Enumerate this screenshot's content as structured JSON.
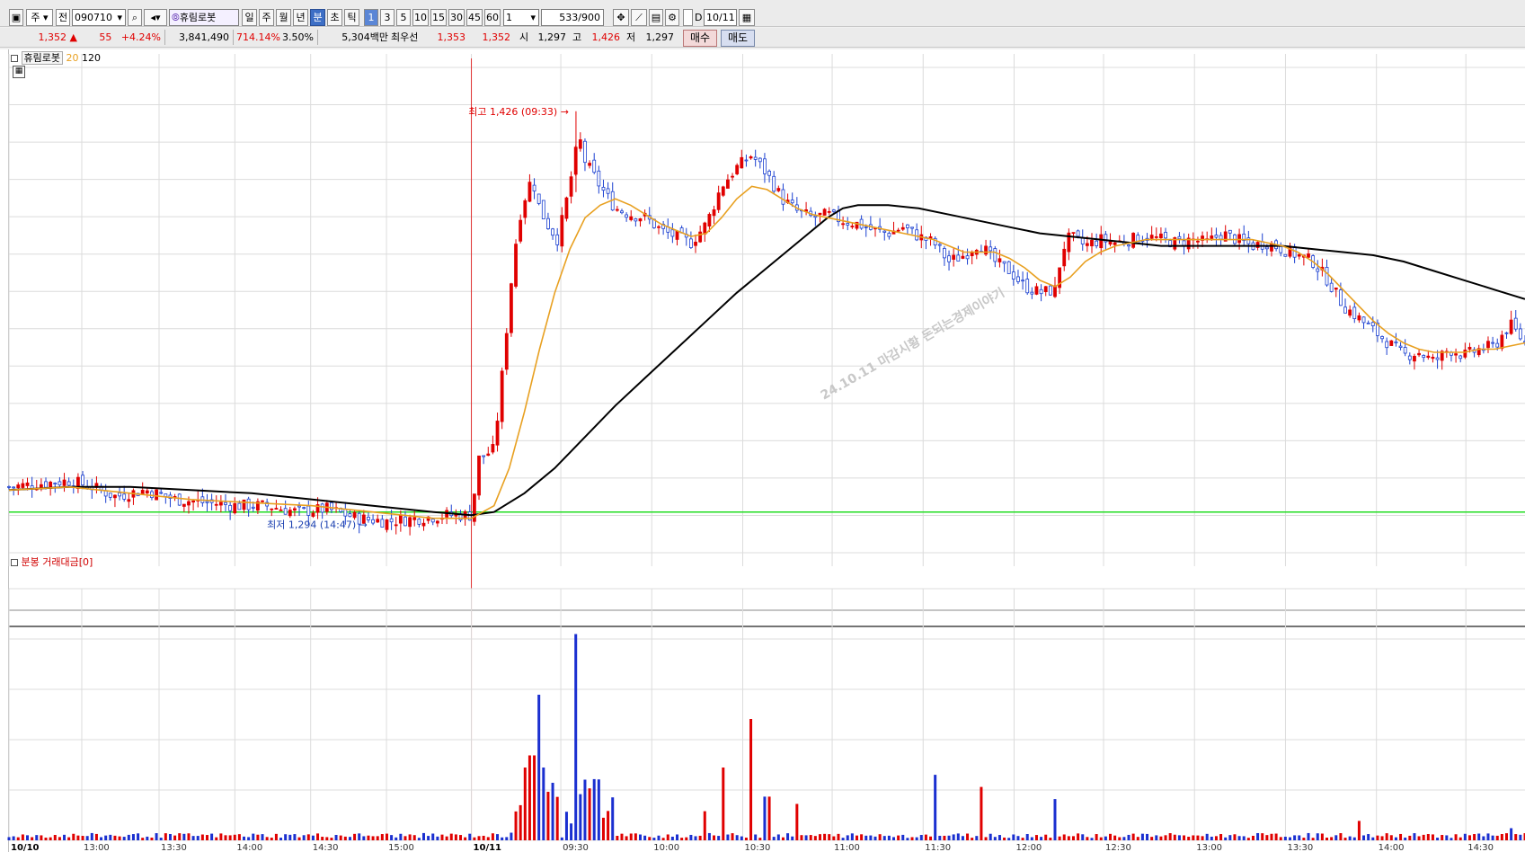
{
  "toolbar": {
    "market_select": "주",
    "type_select": "전",
    "stock_code": "090710",
    "stock_name": "휴림로봇",
    "period_buttons": [
      "일",
      "주",
      "월",
      "년",
      "분",
      "초",
      "틱"
    ],
    "active_period": "분",
    "interval_buttons": [
      "1",
      "3",
      "5",
      "10",
      "15",
      "30",
      "45",
      "60"
    ],
    "active_interval": "1",
    "interval_input": "1",
    "count_value": "533",
    "count_max": "/900",
    "checkbox_label": "D",
    "date_value": "10/11"
  },
  "quote": {
    "price": "1,352",
    "arrow": "▲",
    "change": "55",
    "change_pct": "+4.24%",
    "volume": "3,841,490",
    "volume_ratio": "714.14%",
    "turnover": "3.50%",
    "amount": "5,304백만",
    "best_label": "최우선",
    "best_ask": "1,353",
    "best_bid": "1,352",
    "open_label": "시",
    "open": "1,297",
    "high_label": "고",
    "high": "1,426",
    "low_label": "저",
    "low": "1,297",
    "buy_button": "매수",
    "sell_button": "매도"
  },
  "price_panel": {
    "legend_name": "휴림로봇",
    "ma_short": "20",
    "ma_long": "120",
    "ma_short_color": "#e8a020",
    "ma_long_color": "#000000",
    "high_marker": "최고 1,426 (09:33)",
    "low_marker": "최저 1,294 (14:47)",
    "watermark": "24.10.11 마감시황 돈되는경제이야기"
  },
  "volume_panel": {
    "title": "분봉 거래대금[0]"
  },
  "chart_data": {
    "type": "candlestick",
    "ylim": [
      1285,
      1440
    ],
    "day_separator": "10/11",
    "x_labels": [
      "10/10",
      "13:00",
      "13:30",
      "14:00",
      "14:30",
      "15:00",
      "10/11",
      "09:30",
      "10:00",
      "10:30",
      "11:00",
      "11:30",
      "12:00",
      "12:30",
      "13:00",
      "13:30",
      "14:00",
      "14:30"
    ],
    "x_fracs": [
      0.0,
      0.048,
      0.099,
      0.149,
      0.199,
      0.249,
      0.305,
      0.364,
      0.424,
      0.484,
      0.543,
      0.603,
      0.663,
      0.722,
      0.782,
      0.842,
      0.902,
      0.961
    ],
    "close_path": [
      [
        0.0,
        1306
      ],
      [
        0.02,
        1307
      ],
      [
        0.04,
        1308
      ],
      [
        0.055,
        1306
      ],
      [
        0.07,
        1303
      ],
      [
        0.09,
        1305
      ],
      [
        0.11,
        1302
      ],
      [
        0.13,
        1301
      ],
      [
        0.15,
        1300
      ],
      [
        0.17,
        1300
      ],
      [
        0.19,
        1298
      ],
      [
        0.21,
        1299
      ],
      [
        0.23,
        1296
      ],
      [
        0.25,
        1295
      ],
      [
        0.27,
        1296
      ],
      [
        0.29,
        1297
      ],
      [
        0.305,
        1297
      ],
      [
        0.31,
        1315
      ],
      [
        0.32,
        1318
      ],
      [
        0.326,
        1345
      ],
      [
        0.333,
        1380
      ],
      [
        0.338,
        1395
      ],
      [
        0.345,
        1405
      ],
      [
        0.35,
        1395
      ],
      [
        0.355,
        1390
      ],
      [
        0.362,
        1385
      ],
      [
        0.368,
        1398
      ],
      [
        0.376,
        1418
      ],
      [
        0.38,
        1410
      ],
      [
        0.39,
        1402
      ],
      [
        0.4,
        1395
      ],
      [
        0.41,
        1393
      ],
      [
        0.42,
        1392
      ],
      [
        0.43,
        1388
      ],
      [
        0.44,
        1386
      ],
      [
        0.45,
        1384
      ],
      [
        0.46,
        1390
      ],
      [
        0.47,
        1402
      ],
      [
        0.48,
        1408
      ],
      [
        0.49,
        1412
      ],
      [
        0.5,
        1406
      ],
      [
        0.51,
        1398
      ],
      [
        0.52,
        1394
      ],
      [
        0.53,
        1392
      ],
      [
        0.54,
        1393
      ],
      [
        0.55,
        1391
      ],
      [
        0.56,
        1390
      ],
      [
        0.57,
        1388
      ],
      [
        0.58,
        1387
      ],
      [
        0.59,
        1389
      ],
      [
        0.6,
        1386
      ],
      [
        0.61,
        1384
      ],
      [
        0.62,
        1378
      ],
      [
        0.63,
        1380
      ],
      [
        0.64,
        1384
      ],
      [
        0.65,
        1378
      ],
      [
        0.66,
        1375
      ],
      [
        0.67,
        1370
      ],
      [
        0.68,
        1368
      ],
      [
        0.69,
        1369
      ],
      [
        0.695,
        1382
      ],
      [
        0.7,
        1386
      ],
      [
        0.71,
        1383
      ],
      [
        0.72,
        1385
      ],
      [
        0.73,
        1384
      ],
      [
        0.74,
        1385
      ],
      [
        0.75,
        1386
      ],
      [
        0.76,
        1385
      ],
      [
        0.77,
        1384
      ],
      [
        0.78,
        1385
      ],
      [
        0.79,
        1384
      ],
      [
        0.8,
        1387
      ],
      [
        0.81,
        1385
      ],
      [
        0.82,
        1383
      ],
      [
        0.83,
        1384
      ],
      [
        0.84,
        1382
      ],
      [
        0.85,
        1380
      ],
      [
        0.86,
        1378
      ],
      [
        0.87,
        1372
      ],
      [
        0.88,
        1364
      ],
      [
        0.89,
        1360
      ],
      [
        0.9,
        1356
      ],
      [
        0.91,
        1352
      ],
      [
        0.92,
        1348
      ],
      [
        0.93,
        1349
      ],
      [
        0.94,
        1346
      ],
      [
        0.95,
        1350
      ],
      [
        0.96,
        1348
      ],
      [
        0.97,
        1350
      ],
      [
        0.98,
        1351
      ],
      [
        0.99,
        1358
      ],
      [
        1.0,
        1352
      ]
    ],
    "ma20": [
      [
        0.0,
        1305
      ],
      [
        0.04,
        1306
      ],
      [
        0.08,
        1304
      ],
      [
        0.12,
        1302
      ],
      [
        0.16,
        1301
      ],
      [
        0.2,
        1300
      ],
      [
        0.24,
        1298
      ],
      [
        0.28,
        1296
      ],
      [
        0.305,
        1296
      ],
      [
        0.32,
        1300
      ],
      [
        0.33,
        1312
      ],
      [
        0.34,
        1330
      ],
      [
        0.35,
        1350
      ],
      [
        0.36,
        1368
      ],
      [
        0.37,
        1382
      ],
      [
        0.38,
        1392
      ],
      [
        0.39,
        1396
      ],
      [
        0.4,
        1398
      ],
      [
        0.41,
        1396
      ],
      [
        0.42,
        1393
      ],
      [
        0.43,
        1390
      ],
      [
        0.44,
        1388
      ],
      [
        0.45,
        1386
      ],
      [
        0.46,
        1387
      ],
      [
        0.47,
        1392
      ],
      [
        0.48,
        1398
      ],
      [
        0.49,
        1402
      ],
      [
        0.5,
        1401
      ],
      [
        0.51,
        1398
      ],
      [
        0.52,
        1395
      ],
      [
        0.53,
        1393
      ],
      [
        0.54,
        1392
      ],
      [
        0.55,
        1391
      ],
      [
        0.56,
        1390
      ],
      [
        0.57,
        1389
      ],
      [
        0.58,
        1388
      ],
      [
        0.59,
        1387
      ],
      [
        0.6,
        1386
      ],
      [
        0.61,
        1385
      ],
      [
        0.62,
        1383
      ],
      [
        0.63,
        1381
      ],
      [
        0.64,
        1381
      ],
      [
        0.65,
        1381
      ],
      [
        0.66,
        1379
      ],
      [
        0.67,
        1376
      ],
      [
        0.68,
        1372
      ],
      [
        0.69,
        1370
      ],
      [
        0.7,
        1373
      ],
      [
        0.71,
        1378
      ],
      [
        0.72,
        1381
      ],
      [
        0.73,
        1383
      ],
      [
        0.74,
        1384
      ],
      [
        0.75,
        1385
      ],
      [
        0.76,
        1385
      ],
      [
        0.77,
        1385
      ],
      [
        0.78,
        1385
      ],
      [
        0.79,
        1385
      ],
      [
        0.8,
        1385
      ],
      [
        0.81,
        1385
      ],
      [
        0.82,
        1385
      ],
      [
        0.83,
        1384
      ],
      [
        0.84,
        1383
      ],
      [
        0.85,
        1381
      ],
      [
        0.86,
        1378
      ],
      [
        0.87,
        1374
      ],
      [
        0.88,
        1369
      ],
      [
        0.89,
        1364
      ],
      [
        0.9,
        1359
      ],
      [
        0.91,
        1355
      ],
      [
        0.92,
        1352
      ],
      [
        0.93,
        1350
      ],
      [
        0.94,
        1349
      ],
      [
        0.95,
        1349
      ],
      [
        0.96,
        1349
      ],
      [
        0.97,
        1350
      ],
      [
        0.98,
        1350
      ],
      [
        1.0,
        1352
      ]
    ],
    "ma120": [
      [
        0.0,
        1305
      ],
      [
        0.04,
        1306
      ],
      [
        0.08,
        1306
      ],
      [
        0.12,
        1305
      ],
      [
        0.16,
        1304
      ],
      [
        0.2,
        1302
      ],
      [
        0.24,
        1300
      ],
      [
        0.28,
        1298
      ],
      [
        0.305,
        1297
      ],
      [
        0.32,
        1298
      ],
      [
        0.34,
        1304
      ],
      [
        0.36,
        1312
      ],
      [
        0.38,
        1322
      ],
      [
        0.4,
        1332
      ],
      [
        0.42,
        1341
      ],
      [
        0.44,
        1350
      ],
      [
        0.46,
        1359
      ],
      [
        0.48,
        1368
      ],
      [
        0.5,
        1376
      ],
      [
        0.52,
        1384
      ],
      [
        0.54,
        1392
      ],
      [
        0.55,
        1395
      ],
      [
        0.56,
        1396
      ],
      [
        0.58,
        1396
      ],
      [
        0.6,
        1395
      ],
      [
        0.62,
        1393
      ],
      [
        0.64,
        1391
      ],
      [
        0.66,
        1389
      ],
      [
        0.68,
        1387
      ],
      [
        0.7,
        1386
      ],
      [
        0.72,
        1385
      ],
      [
        0.74,
        1384
      ],
      [
        0.76,
        1383
      ],
      [
        0.78,
        1383
      ],
      [
        0.8,
        1383
      ],
      [
        0.82,
        1383
      ],
      [
        0.84,
        1383
      ],
      [
        0.86,
        1382
      ],
      [
        0.88,
        1381
      ],
      [
        0.9,
        1380
      ],
      [
        0.92,
        1378
      ],
      [
        0.94,
        1375
      ],
      [
        0.96,
        1372
      ],
      [
        0.98,
        1369
      ],
      [
        1.0,
        1366
      ]
    ],
    "high": {
      "x": 0.374,
      "value": 1426
    },
    "low": {
      "x": 0.24,
      "value": 1294
    },
    "support_line": 1298,
    "volume_spikes": [
      [
        0.34,
        0.3
      ],
      [
        0.345,
        0.35
      ],
      [
        0.35,
        0.6
      ],
      [
        0.353,
        0.3
      ],
      [
        0.357,
        0.2
      ],
      [
        0.375,
        0.85
      ],
      [
        0.38,
        0.25
      ],
      [
        0.39,
        0.1
      ],
      [
        0.46,
        0.12
      ],
      [
        0.47,
        0.3
      ],
      [
        0.49,
        0.5
      ],
      [
        0.5,
        0.18
      ],
      [
        0.52,
        0.15
      ],
      [
        0.61,
        0.27
      ],
      [
        0.64,
        0.22
      ],
      [
        0.69,
        0.17
      ],
      [
        0.89,
        0.08
      ],
      [
        0.99,
        0.05
      ]
    ]
  }
}
